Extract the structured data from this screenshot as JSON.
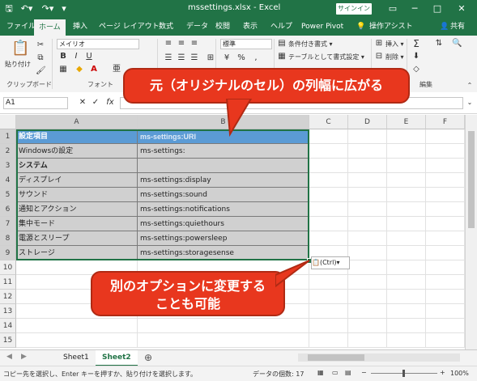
{
  "titlebar": {
    "title": "mssettings.xlsx  -  Excel",
    "signin": "サインイン",
    "minimize": "─",
    "restore": "□",
    "close": "✕"
  },
  "tabs": [
    "ファイル",
    "ホーム",
    "挿入",
    "ページ レイアウト",
    "数式",
    "データ",
    "校閲",
    "表示",
    "ヘルプ",
    "Power Pivot"
  ],
  "tell_me": "操作アシスト",
  "share": "共有",
  "ribbon": {
    "paste": "貼り付け",
    "font_name": "メイリオ",
    "number_format": "標準",
    "conditional_format": "条件付き書式 ▾",
    "format_as_table": "テーブルとして書式設定 ▾",
    "insert": "挿入 ▾",
    "delete": "削除 ▾",
    "group_clipboard": "クリップボード",
    "group_font": "フォント",
    "group_edit": "編集"
  },
  "namebox": "A1",
  "columns": [
    "A",
    "B",
    "C",
    "D",
    "E",
    "F"
  ],
  "rows": [
    {
      "num": "1",
      "a": "設定項目",
      "b": "ms-settings:URI"
    },
    {
      "num": "2",
      "a": "Windowsの設定",
      "b": "ms-settings:"
    },
    {
      "num": "3",
      "a": "システム",
      "b": ""
    },
    {
      "num": "4",
      "a": "ディスプレイ",
      "b": "ms-settings:display"
    },
    {
      "num": "5",
      "a": "サウンド",
      "b": "ms-settings:sound"
    },
    {
      "num": "6",
      "a": "通知とアクション",
      "b": "ms-settings:notifications"
    },
    {
      "num": "7",
      "a": "集中モード",
      "b": "ms-settings:quiethours"
    },
    {
      "num": "8",
      "a": "電源とスリープ",
      "b": "ms-settings:powersleep"
    },
    {
      "num": "9",
      "a": "ストレージ",
      "b": "ms-settings:storagesense"
    },
    {
      "num": "10",
      "a": "",
      "b": ""
    },
    {
      "num": "11",
      "a": "",
      "b": ""
    },
    {
      "num": "12",
      "a": "",
      "b": ""
    },
    {
      "num": "13",
      "a": "",
      "b": ""
    },
    {
      "num": "14",
      "a": "",
      "b": ""
    },
    {
      "num": "15",
      "a": "",
      "b": ""
    }
  ],
  "paste_options": "(Ctrl)▾",
  "sheets": [
    "Sheet1",
    "Sheet2"
  ],
  "status": {
    "message": "コピー先を選択し、Enter キーを押すか、貼り付けを選択します。",
    "count": "データの個数: 17",
    "zoom": "100%"
  },
  "callouts": {
    "top": "元（オリジナルのセル）の列幅に広がる",
    "bottom_line1": "別のオプションに変更する",
    "bottom_line2": "ことも可能"
  },
  "colors": {
    "excel_green": "#217346",
    "header_blue": "#5b9bd5",
    "callout_red": "#e8371e"
  }
}
